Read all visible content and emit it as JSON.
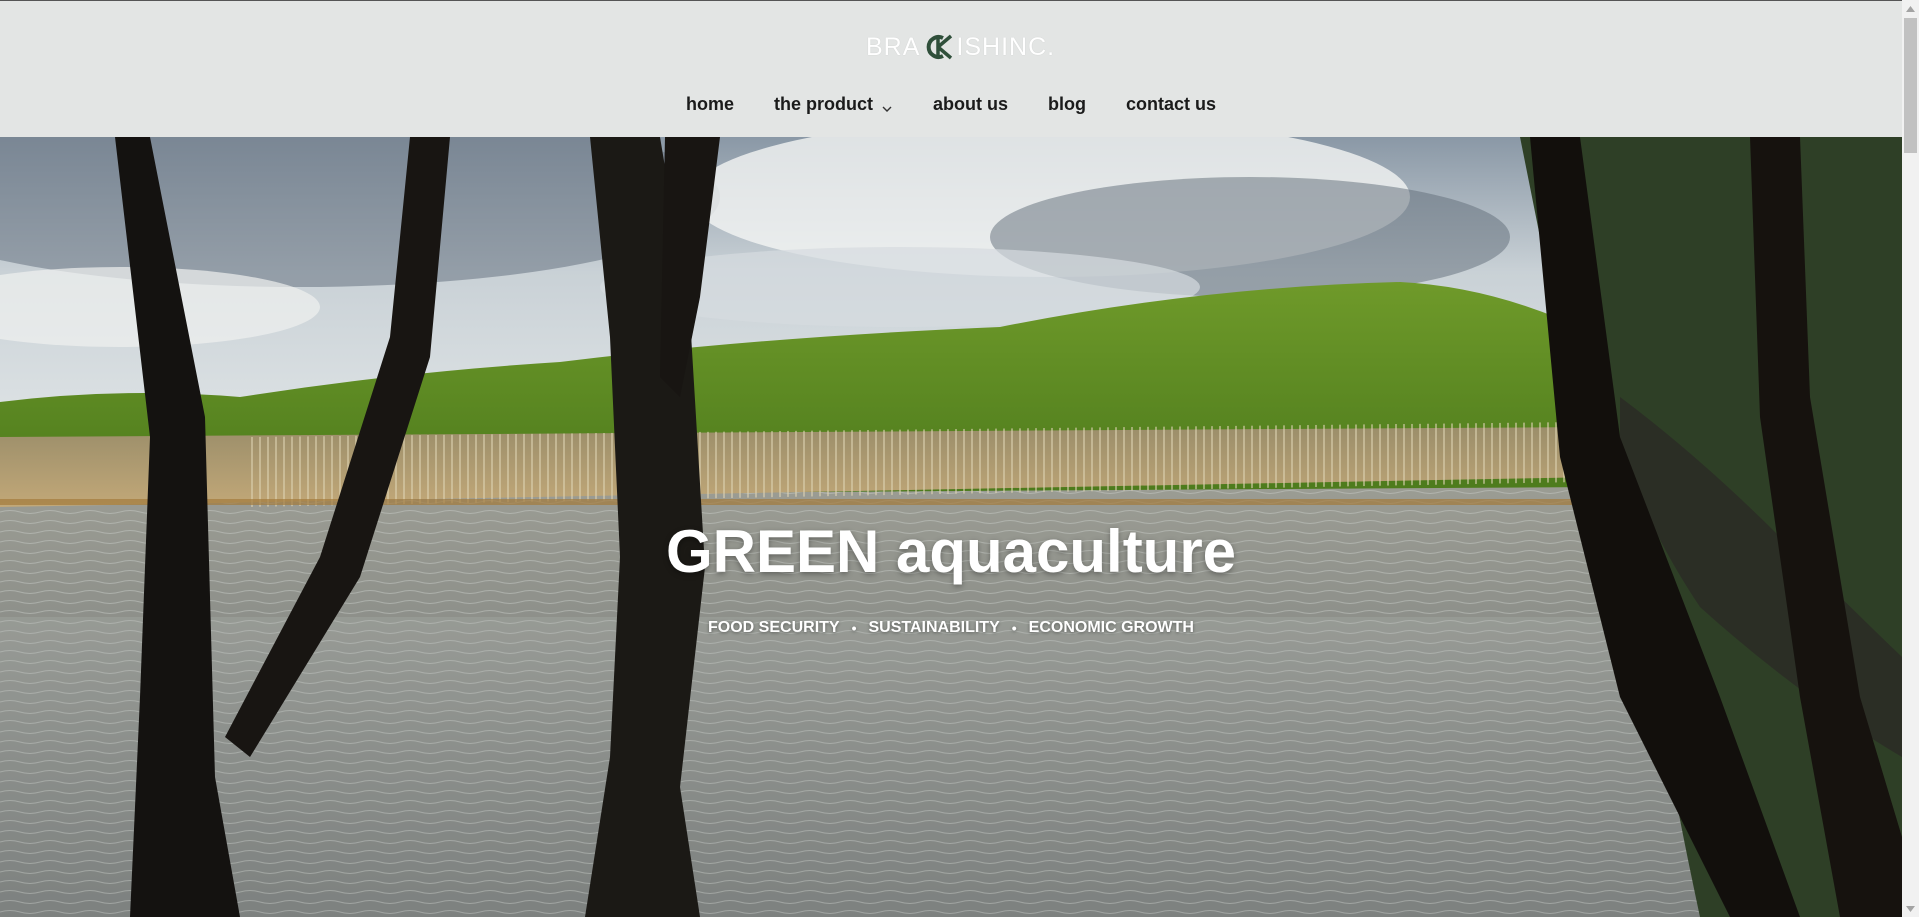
{
  "brand": {
    "logo_left": "BRA",
    "logo_mark": "CK",
    "logo_right": "ISHINC.",
    "accent_color": "#2f4f3a"
  },
  "nav": {
    "items": [
      {
        "label": "home"
      },
      {
        "label": "the product",
        "has_dropdown": true
      },
      {
        "label": "about us"
      },
      {
        "label": "blog"
      },
      {
        "label": "contact us"
      }
    ]
  },
  "hero": {
    "title": "GREEN aquaculture",
    "tags": [
      "FOOD SECURITY",
      "SUSTAINABILITY",
      "ECONOMIC GROWTH"
    ],
    "separator": "•",
    "image_desc_icon": "mangrove-lake-photo"
  },
  "scrollbar": {
    "up_icon": "scroll-up-arrow-icon",
    "down_icon": "scroll-down-arrow-icon"
  }
}
